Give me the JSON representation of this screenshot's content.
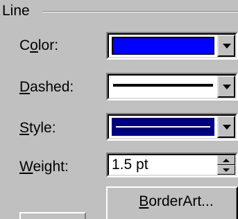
{
  "group": {
    "title": "Line"
  },
  "fields": {
    "color": {
      "label_mnemonic_before": "C",
      "label_mnemonic": "o",
      "label_rest": "lor:",
      "value_color": "#0000ff"
    },
    "dashed": {
      "label_mnemonic": "D",
      "label_rest": "ashed:"
    },
    "style": {
      "label_mnemonic": "S",
      "label_rest": "tyle:",
      "selected_bg": "#000080"
    },
    "weight": {
      "label_mnemonic": "W",
      "label_rest": "eight:",
      "value": "1.5 pt"
    }
  },
  "buttons": {
    "border_art": {
      "label_mnemonic": "B",
      "label_rest": "orderArt..."
    }
  },
  "icons": {
    "dropdown": "chevron-down-icon",
    "spin_up": "spin-up-icon",
    "spin_down": "spin-down-icon"
  }
}
